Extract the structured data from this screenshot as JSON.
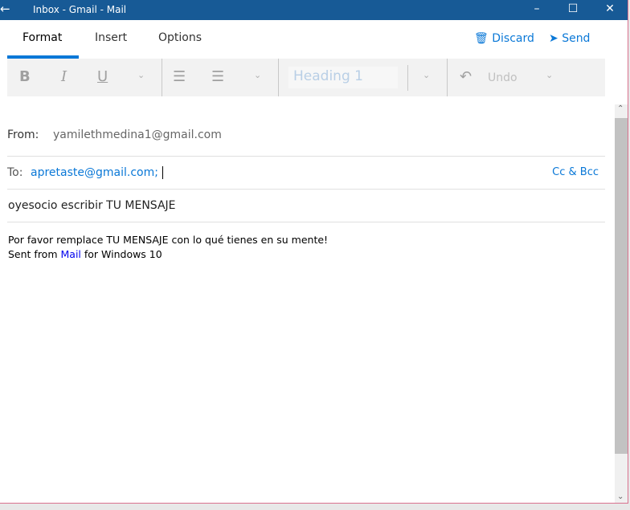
{
  "window": {
    "title": "Inbox - Gmail - Mail",
    "titlebar_color": "#175a96"
  },
  "tabs": [
    {
      "label": "Format",
      "active": true
    },
    {
      "label": "Insert"
    },
    {
      "label": "Options"
    }
  ],
  "actions": {
    "discard": "Discard",
    "send": "Send"
  },
  "toolbar": {
    "bold": "B",
    "italic": "I",
    "underline": "U",
    "style": "Heading 1",
    "undo": "Undo"
  },
  "from": {
    "label": "From:",
    "value": "yamilethmedina1@gmail.com"
  },
  "to": {
    "label": "To:",
    "value": "apretaste@gmail.com;",
    "cc_bcc": "Cc & Bcc"
  },
  "subject": "oyesocio escribir TU MENSAJE",
  "body": {
    "line1": "Por favor remplace TU MENSAJE con lo qué tienes en su mente!",
    "sent_prefix": "Sent from ",
    "link": "Mail",
    "sent_suffix": " for Windows 10"
  },
  "accent_color": "#0a78d7"
}
